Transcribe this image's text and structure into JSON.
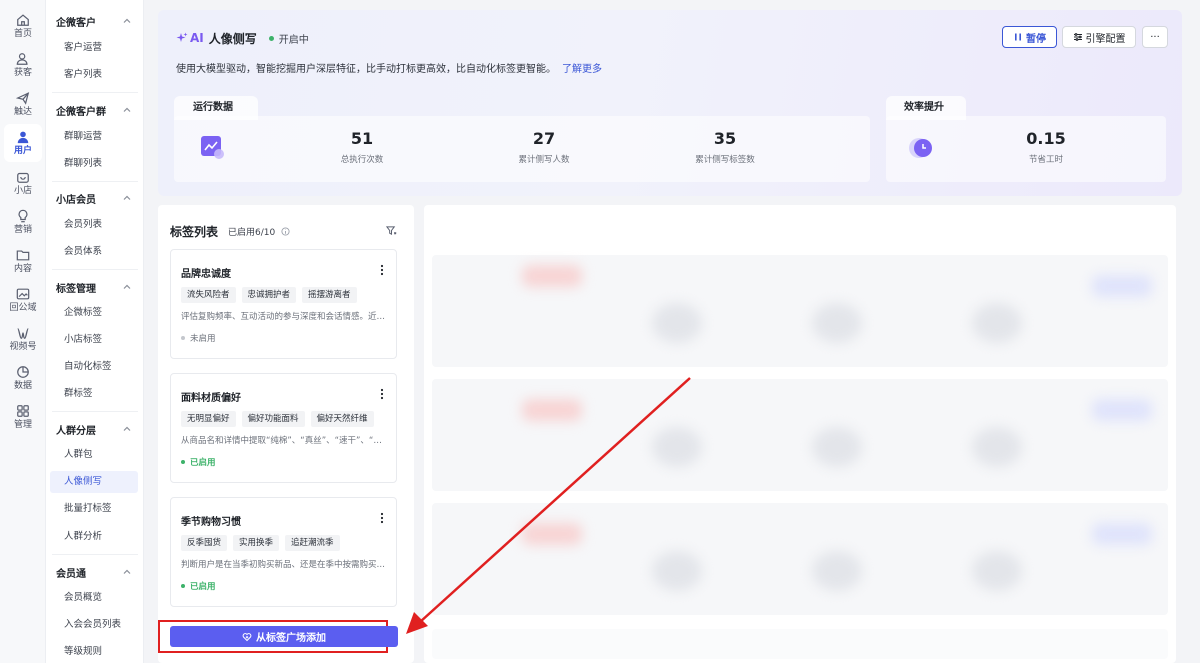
{
  "rail": [
    {
      "label": "首页",
      "icon": "home-icon"
    },
    {
      "label": "获客",
      "icon": "user-add-icon"
    },
    {
      "label": "触达",
      "icon": "send-icon"
    },
    {
      "label": "用户",
      "icon": "user-icon",
      "active": true
    },
    {
      "label": "小店",
      "icon": "shop-icon"
    },
    {
      "label": "营销",
      "icon": "bulb-icon"
    },
    {
      "label": "内容",
      "icon": "folder-icon"
    },
    {
      "label": "回公域",
      "icon": "image-icon"
    },
    {
      "label": "视频号",
      "icon": "channel-icon"
    },
    {
      "label": "数据",
      "icon": "pie-icon"
    },
    {
      "label": "管理",
      "icon": "grid-icon"
    }
  ],
  "subnav": [
    {
      "title": "企微客户",
      "items": [
        "客户运营",
        "客户列表"
      ]
    },
    {
      "title": "企微客户群",
      "items": [
        "群聊运营",
        "群聊列表"
      ]
    },
    {
      "title": "小店会员",
      "items": [
        "会员列表",
        "会员体系"
      ]
    },
    {
      "title": "标签管理",
      "items": [
        "企微标签",
        "小店标签",
        "自动化标签",
        "群标签"
      ]
    },
    {
      "title": "人群分层",
      "items": [
        "人群包",
        "人像侧写",
        "批量打标签",
        "人群分析"
      ]
    },
    {
      "title": "会员通",
      "items": [
        "会员概览",
        "入会会员列表",
        "等级规则"
      ]
    }
  ],
  "header": {
    "ai_label": "AI",
    "title": "人像侧写",
    "status": "开启中",
    "description": "使用大模型驱动，智能挖掘用户深层特征，比手动打标更高效，比自动化标签更智能。",
    "learn_more": "了解更多",
    "pause_label": "暂停",
    "engine_label": "引擎配置",
    "more_label": "···",
    "accent_color": "#3b57d6",
    "ai_color": "#7a5af0"
  },
  "stats": {
    "tab_label": "运行数据",
    "items": [
      {
        "value": "51",
        "label": "总执行次数"
      },
      {
        "value": "27",
        "label": "累计侧写人数"
      },
      {
        "value": "35",
        "label": "累计侧写标签数"
      }
    ]
  },
  "efficiency": {
    "tab_label": "效率提升",
    "value": "0.15",
    "label": "节省工时"
  },
  "tags": {
    "title": "标签列表",
    "count": "已启用6/10",
    "cards": [
      {
        "title": "品牌忠诚度",
        "chips": [
          "流失风险者",
          "忠诚拥护者",
          "摇摆游离者"
        ],
        "desc": "评估复购频率、互动活动的参与深度和会话情感。近期...",
        "status": "未启用",
        "enabled": false
      },
      {
        "title": "面料材质偏好",
        "chips": [
          "无明显偏好",
          "偏好功能面料",
          "偏好天然纤维"
        ],
        "desc": "从商品名和详情中提取“纯棉”、“真丝”、“速干”、“防水...",
        "status": "已启用",
        "enabled": true
      },
      {
        "title": "季节购物习惯",
        "chips": [
          "反季囤货",
          "实用换季",
          "追赶潮流季"
        ],
        "desc": "判断用户是在当季初购买新品、还是在季中按需购买，...",
        "status": "已启用",
        "enabled": true
      }
    ],
    "add_button": "从标签广场添加"
  }
}
